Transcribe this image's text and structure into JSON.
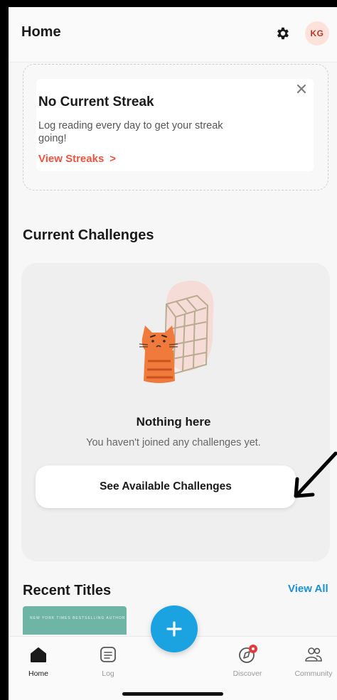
{
  "header": {
    "title": "Home",
    "avatar_initials": "KG",
    "gear_icon": "gear-icon"
  },
  "streak": {
    "title": "No Current Streak",
    "description": "Log reading every day to get your streak going!",
    "link_label": "View Streaks",
    "link_chevron": ">",
    "accent": "#e8553f"
  },
  "challenges": {
    "title": "Current Challenges",
    "empty_title": "Nothing here",
    "empty_desc": "You haven't joined any challenges yet.",
    "cta_label": "See Available Challenges"
  },
  "recent": {
    "title": "Recent Titles",
    "view_all": "View All",
    "book_banner": "NEW YORK TIMES BESTSELLING AUTHOR"
  },
  "nav": {
    "items": [
      {
        "label": "Home",
        "icon": "home-icon",
        "active": true
      },
      {
        "label": "Log",
        "icon": "log-icon",
        "active": false
      },
      {
        "label": "Discover",
        "icon": "compass-icon",
        "active": false
      },
      {
        "label": "Community",
        "icon": "people-icon",
        "active": false
      }
    ],
    "fab_icon": "plus-icon",
    "accent": "#1aa3e0"
  }
}
